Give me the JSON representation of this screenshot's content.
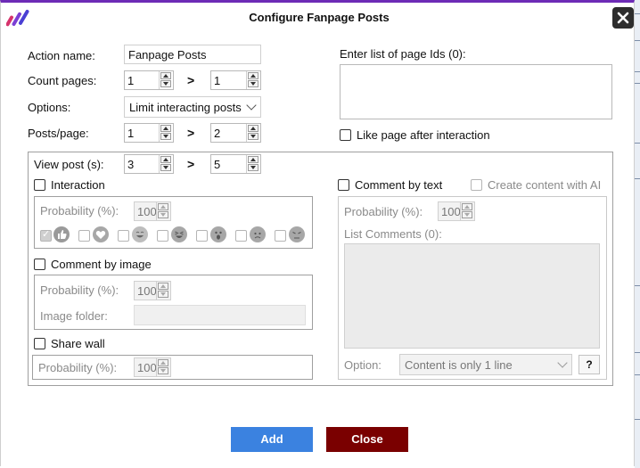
{
  "window": {
    "title": "Configure Fanpage Posts"
  },
  "form": {
    "action_name_label": "Action name:",
    "action_name_value": "Fanpage Posts",
    "count_pages_label": "Count pages:",
    "count_pages_from": "1",
    "count_pages_to": "1",
    "options_label": "Options:",
    "options_value": "Limit interacting posts",
    "posts_per_page_label": "Posts/page:",
    "posts_per_page_from": "1",
    "posts_per_page_to": "2",
    "range_separator": ">",
    "page_ids_label": "Enter list of page Ids (0):",
    "like_page_label": "Like page after interaction"
  },
  "view_post": {
    "label": "View post (s):",
    "from": "3",
    "to": "5"
  },
  "interaction": {
    "label": "Interaction",
    "probability_label": "Probability (%):",
    "probability_value": "100",
    "reactions": [
      "like-icon",
      "love-icon",
      "haha-icon",
      "laugh-icon",
      "wow-icon",
      "sad-icon",
      "angry-icon"
    ]
  },
  "comment_image": {
    "label": "Comment by image",
    "probability_label": "Probability (%):",
    "probability_value": "100",
    "folder_label": "Image folder:"
  },
  "share_wall": {
    "label": "Share wall",
    "probability_label": "Probability (%):",
    "probability_value": "100"
  },
  "comment_text": {
    "label": "Comment by text",
    "ai_label": "Create content with AI",
    "probability_label": "Probability (%):",
    "probability_value": "100",
    "list_label": "List Comments (0):",
    "option_label": "Option:",
    "option_value": "Content is only 1 line",
    "help_label": "?"
  },
  "buttons": {
    "add": "Add",
    "close": "Close"
  },
  "colors": {
    "accent": "#6d2bb6",
    "add_button": "#3b82e0",
    "close_button": "#7a0000"
  }
}
